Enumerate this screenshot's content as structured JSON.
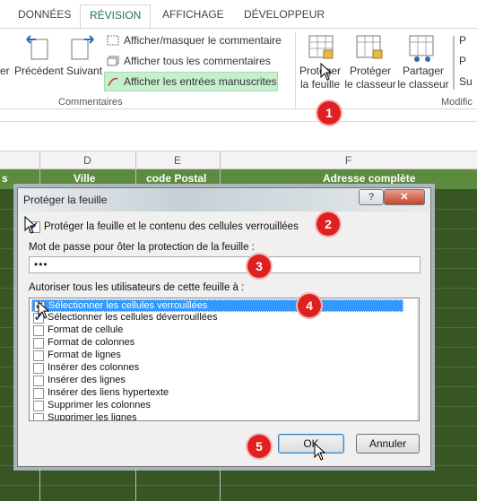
{
  "ribbon_tabs": {
    "donnees": "DONNÉES",
    "revision": "RÉVISION",
    "affichage": "AFFICHAGE",
    "developpeur": "DÉVELOPPEUR"
  },
  "ribbon": {
    "partial_left": "er",
    "precedent": "Précédent",
    "suivant": "Suivant",
    "show_hide_comment": "Afficher/masquer le commentaire",
    "show_all_comments": "Afficher tous les commentaires",
    "show_ink": "Afficher les entrées manuscrites",
    "group_comments": "Commentaires",
    "protect_sheet_1": "Protéger",
    "protect_sheet_2": "la feuille",
    "protect_workbook_1": "Protéger",
    "protect_workbook_2": "le classeur",
    "share_workbook_1": "Partager",
    "share_workbook_2": "le classeur",
    "group_changes": "Modific",
    "cut_p1": "P",
    "cut_p2": "P",
    "cut_su": "Su"
  },
  "sheet": {
    "columns": {
      "d": "D",
      "e": "E",
      "f": "F"
    },
    "headers": {
      "partial": "s",
      "ville": "Ville",
      "code_postal": "code Postal",
      "adresse": "Adresse complète"
    }
  },
  "dialog": {
    "title": "Protéger la feuille",
    "help": "?",
    "close": "✕",
    "protect_label": "Protéger la feuille et le contenu des cellules verrouillées",
    "protect_checked": true,
    "password_label": "Mot de passe pour ôter la protection de la feuille :",
    "password_value": "•••",
    "allow_label": "Autoriser tous les utilisateurs de cette feuille à :",
    "items": [
      {
        "label": "Sélectionner les cellules verrouillées",
        "checked": true,
        "selected": true
      },
      {
        "label": "Sélectionner les cellules déverrouillées",
        "checked": true,
        "selected": false
      },
      {
        "label": "Format de cellule",
        "checked": false,
        "selected": false
      },
      {
        "label": "Format de colonnes",
        "checked": false,
        "selected": false
      },
      {
        "label": "Format de lignes",
        "checked": false,
        "selected": false
      },
      {
        "label": "Insérer des colonnes",
        "checked": false,
        "selected": false
      },
      {
        "label": "Insérer des lignes",
        "checked": false,
        "selected": false
      },
      {
        "label": "Insérer des liens hypertexte",
        "checked": false,
        "selected": false
      },
      {
        "label": "Supprimer les colonnes",
        "checked": false,
        "selected": false
      },
      {
        "label": "Supprimer les lignes",
        "checked": false,
        "selected": false
      }
    ],
    "ok": "OK",
    "cancel": "Annuler"
  },
  "markers": [
    "1",
    "2",
    "3",
    "4",
    "5"
  ],
  "colors": {
    "accent_green": "#217346",
    "sheet_dark_green": "#375623",
    "header_green": "#5c8a3e",
    "marker_red": "#e02020",
    "selection_blue": "#3399ff"
  }
}
